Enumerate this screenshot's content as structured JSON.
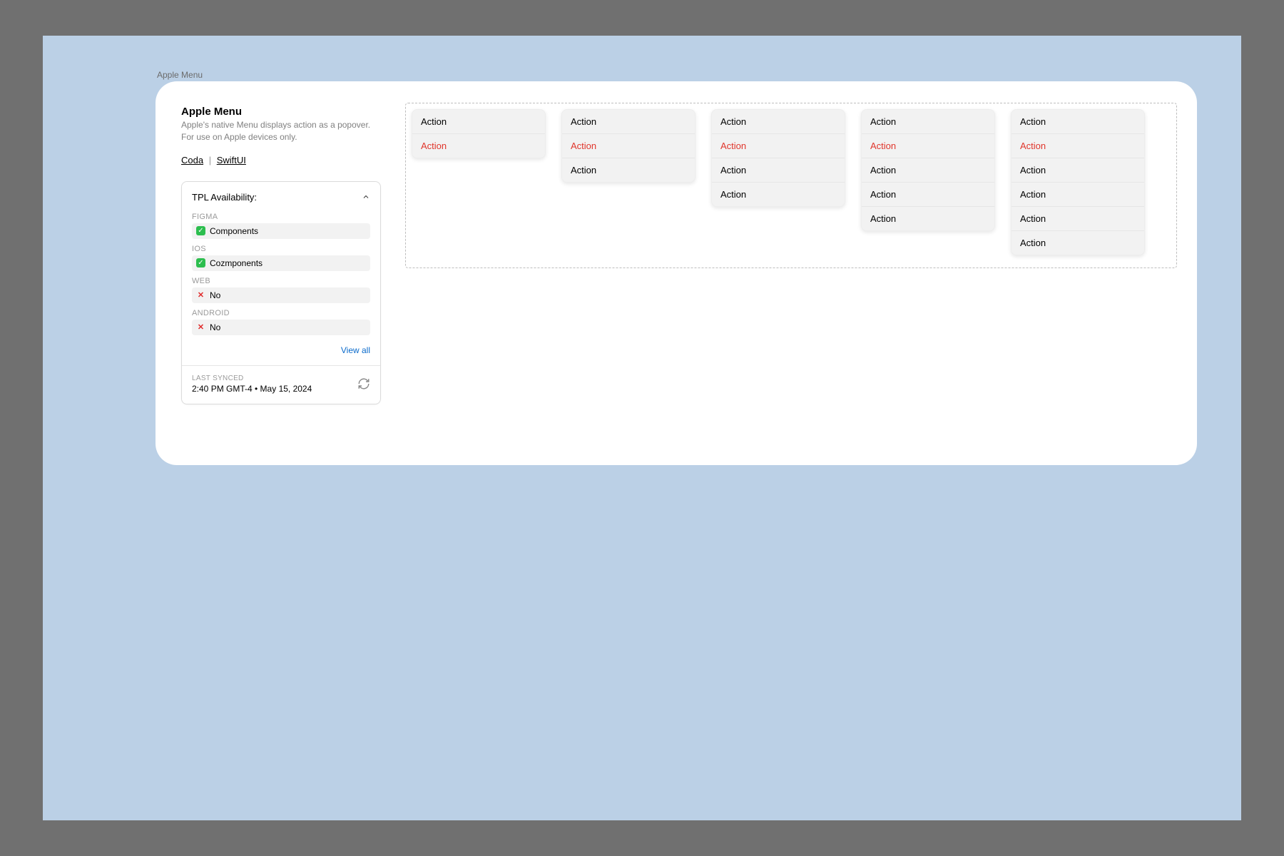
{
  "frame_label": "Apple Menu",
  "header": {
    "title": "Apple Menu",
    "description": "Apple's native Menu displays action as a popover. For use on Apple devices only.",
    "links": {
      "coda": "Coda",
      "swiftui": "SwiftUI"
    }
  },
  "availability": {
    "card_title": "TPL Availability:",
    "groups": [
      {
        "name": "FIGMA",
        "status": "ok",
        "label": "Components"
      },
      {
        "name": "IOS",
        "status": "ok",
        "label": "Cozmponents"
      },
      {
        "name": "WEB",
        "status": "no",
        "label": "No"
      },
      {
        "name": "ANDROID",
        "status": "no",
        "label": "No"
      }
    ],
    "view_all": "View all",
    "last_synced_label": "LAST SYNCED",
    "last_synced_value": "2:40 PM GMT-4 • May 15, 2024"
  },
  "menus": [
    {
      "items": [
        {
          "label": "Action"
        },
        {
          "label": "Action",
          "destructive": true
        }
      ]
    },
    {
      "items": [
        {
          "label": "Action"
        },
        {
          "label": "Action",
          "destructive": true
        },
        {
          "label": "Action"
        }
      ]
    },
    {
      "items": [
        {
          "label": "Action"
        },
        {
          "label": "Action",
          "destructive": true
        },
        {
          "label": "Action"
        },
        {
          "label": "Action"
        }
      ]
    },
    {
      "items": [
        {
          "label": "Action"
        },
        {
          "label": "Action",
          "destructive": true
        },
        {
          "label": "Action"
        },
        {
          "label": "Action"
        },
        {
          "label": "Action"
        }
      ]
    },
    {
      "items": [
        {
          "label": "Action"
        },
        {
          "label": "Action",
          "destructive": true
        },
        {
          "label": "Action"
        },
        {
          "label": "Action"
        },
        {
          "label": "Action"
        },
        {
          "label": "Action"
        }
      ]
    }
  ]
}
